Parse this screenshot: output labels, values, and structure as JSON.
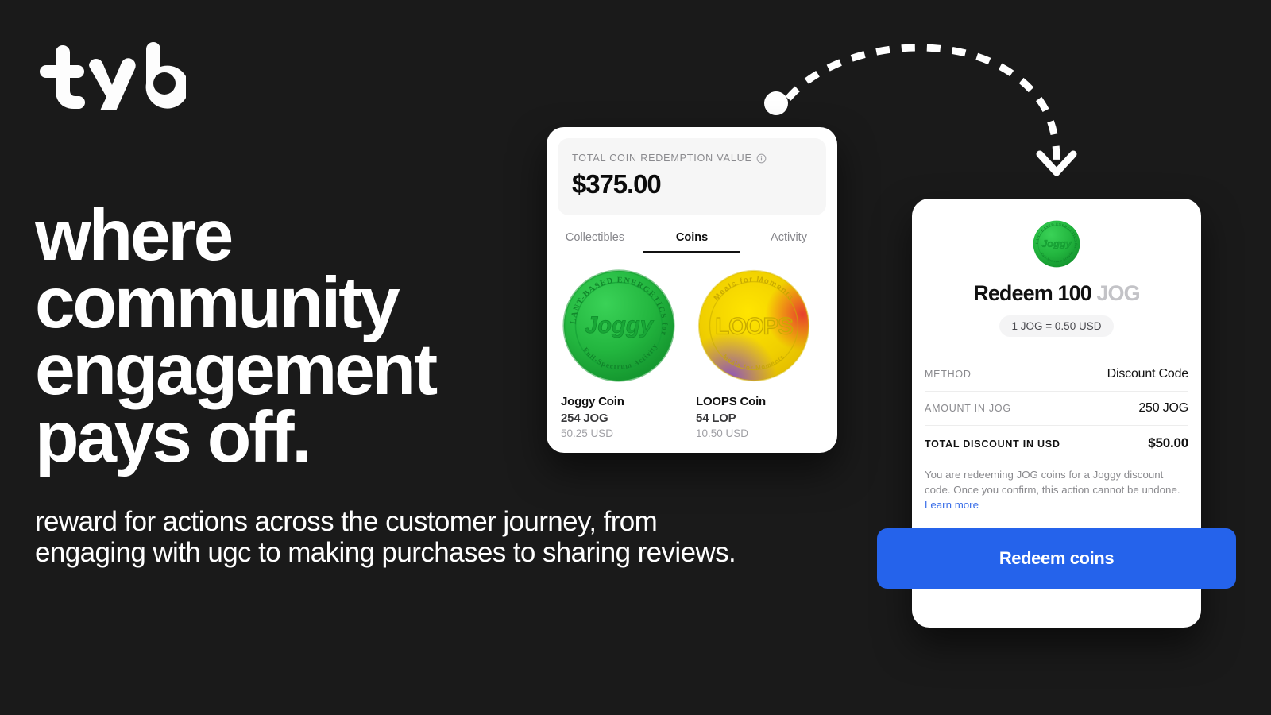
{
  "brand": {
    "logo_text": "tyb"
  },
  "hero": {
    "headline_lines": [
      "where",
      "community",
      "engagement",
      "pays off."
    ],
    "subcopy_lines": [
      "reward for actions across the customer journey, from",
      "engaging with ugc to making purchases to sharing reviews."
    ],
    "background_color": "#1a1a1a",
    "text_color": "#ffffff"
  },
  "arrow": {
    "icon": "curved-dashed-arrow",
    "color": "#ffffff"
  },
  "wallet_card": {
    "value_label": "TOTAL COIN REDEMPTION VALUE",
    "info_icon": "info-circle-icon",
    "value_amount": "$375.00",
    "tabs": [
      {
        "label": "Collectibles",
        "active": false
      },
      {
        "label": "Coins",
        "active": true
      },
      {
        "label": "Activity",
        "active": false
      }
    ],
    "coins": [
      {
        "icon": "joggy-coin-icon",
        "name": "Joggy Coin",
        "amount": "254 JOG",
        "usd": "50.25 USD",
        "center_text": "Joggy",
        "ring_text": "PLANT-BASED ENERGETICS for Full-Spectrum Activity",
        "color": "#22b33e"
      },
      {
        "icon": "loops-coin-icon",
        "name": "LOOPS Coin",
        "amount": "54 LOP",
        "usd": "10.50 USD",
        "center_text": "LOOPS",
        "ring_text": "Meals for Moments",
        "color": "#f2d200"
      }
    ]
  },
  "redeem_card": {
    "coin_icon": "joggy-coin-icon",
    "title_action": "Redeem 100",
    "title_unit": "JOG",
    "rate_pill": "1 JOG = 0.50 USD",
    "rows": [
      {
        "key": "METHOD",
        "value": "Discount Code",
        "total": false
      },
      {
        "key": "AMOUNT IN JOG",
        "value": "250 JOG",
        "total": false
      },
      {
        "key": "TOTAL DISCOUNT IN USD",
        "value": "$50.00",
        "total": true
      }
    ],
    "disclaimer_text": "You are redeeming JOG coins for a Joggy discount code. Once you confirm, this action cannot be undone. ",
    "disclaimer_link": "Learn more",
    "cta_label": "Redeem coins",
    "cta_color": "#2563eb"
  }
}
